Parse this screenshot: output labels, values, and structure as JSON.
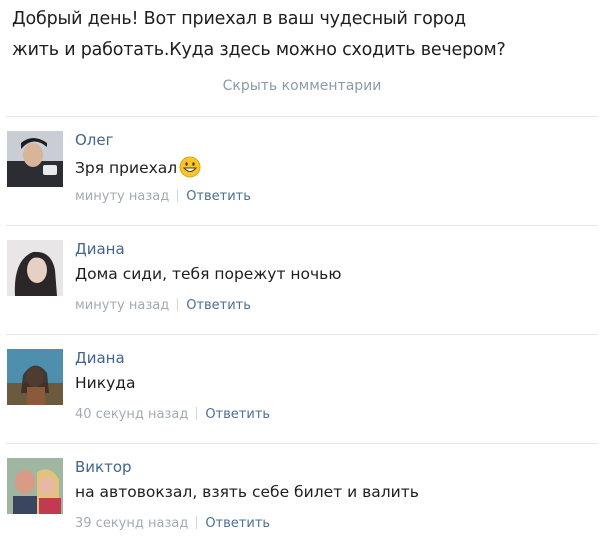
{
  "post": {
    "line1": "Добрый день! Вот приехал в ваш чудесный город",
    "line2": "жить и работать.Куда здесь можно сходить вечером?"
  },
  "hide_comments_label": "Скрыть комментарии",
  "reply_label": "Ответить",
  "comments": [
    {
      "author": "Олег",
      "text": "Зря приехал",
      "time": "минуту назад",
      "emoji": "grinning-face-icon"
    },
    {
      "author": "Диана",
      "text": "Дома сиди, тебя порежут ночью",
      "time": "минуту назад"
    },
    {
      "author": "Диана",
      "text": "Никуда",
      "time": "40 секунд назад"
    },
    {
      "author": "Виктор",
      "text": "на автовокзал, взять себе билет и валить",
      "time": "39 секунд назад"
    }
  ],
  "colors": {
    "link": "#43658d",
    "muted": "#a2abb5",
    "separator": "#e4e8ec"
  }
}
